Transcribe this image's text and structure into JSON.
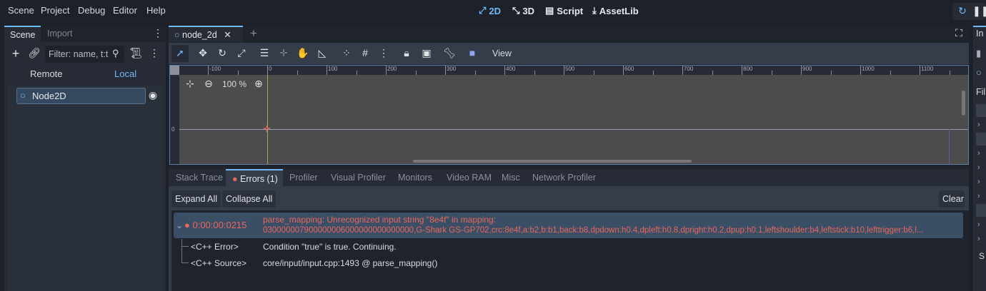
{
  "menu": [
    "Scene",
    "Project",
    "Debug",
    "Editor",
    "Help"
  ],
  "workspaces": [
    {
      "icon": "2d-icon",
      "label": "2D",
      "active": true
    },
    {
      "icon": "3d-icon",
      "label": "3D"
    },
    {
      "icon": "script-icon",
      "label": "Script"
    },
    {
      "icon": "assetlib-icon",
      "label": "AssetLib"
    }
  ],
  "scene_dock": {
    "tabs": [
      "Scene",
      "Import"
    ],
    "filter_placeholder": "Filter: name, t:t",
    "remote": "Remote",
    "local": "Local",
    "tree": [
      {
        "name": "Node2D"
      }
    ]
  },
  "editor": {
    "scene_tab": "node_2d",
    "view_menu": "View",
    "zoom": "100 %",
    "ruler": [
      "-100",
      "0",
      "100",
      "200",
      "300",
      "400",
      "500",
      "600",
      "700",
      "800",
      "900",
      "1000",
      "1100"
    ],
    "ruler_left": "0"
  },
  "bottom": {
    "tabs": [
      "Stack Trace",
      "Errors (1)",
      "Profiler",
      "Visual Profiler",
      "Monitors",
      "Video RAM",
      "Misc",
      "Network Profiler"
    ],
    "expand_all": "Expand All",
    "collapse_all": "Collapse All",
    "clear": "Clear",
    "error": {
      "time": "0:00:00:0215",
      "line1": "parse_mapping: Unrecognized input string \"8e4f\" in mapping:",
      "line2": "030000007900000006000000000000000,G-Shark GS-GP702,crc:8e4f,a:b2,b:b1,back:b8,dpdown:h0.4,dpleft:h0.8,dpright:h0.2,dpup:h0.1,leftshoulder:b4,leftstick:b10,lefttrigger:b6,l...",
      "details": [
        {
          "label": "<C++ Error>",
          "value": "Condition \"true\" is true. Continuing."
        },
        {
          "label": "<C++ Source>",
          "value": "core/input/input.cpp:1493 @ parse_mapping()"
        }
      ]
    }
  },
  "inspector": {
    "tab": "In",
    "filter": "Fil",
    "section": "S"
  },
  "colors": {
    "accent": "#70bafa",
    "error": "#e9675d",
    "selected_row": "#3a4e66"
  }
}
